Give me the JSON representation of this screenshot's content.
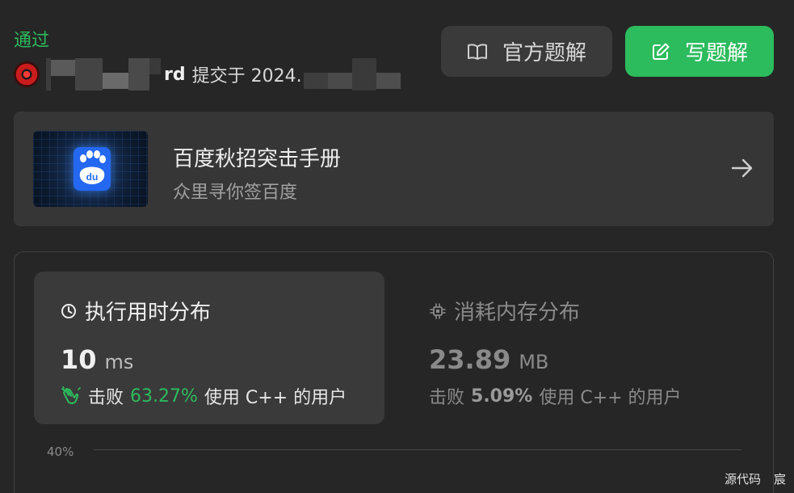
{
  "submission": {
    "status": "通过",
    "username_tail": "rd",
    "submitted_text": "提交于 2024."
  },
  "buttons": {
    "official_solution": "官方题解",
    "write_solution": "写题解"
  },
  "promo": {
    "title": "百度秋招突击手册",
    "subtitle": "众里寻你签百度",
    "logo_text": "du"
  },
  "runtime": {
    "heading": "执行用时分布",
    "value": "10",
    "unit": "ms",
    "beat_label": "击败",
    "beat_percent": "63.27%",
    "beat_suffix": "使用 C++ 的用户"
  },
  "memory": {
    "heading": "消耗内存分布",
    "value": "23.89",
    "unit": "MB",
    "beat_label": "击败",
    "beat_percent": "5.09%",
    "beat_suffix": "使用 C++ 的用户"
  },
  "chart": {
    "y_tick": "40%"
  },
  "footer": {
    "left": "源代码",
    "right": "宸"
  },
  "colors": {
    "background": "#262626",
    "accent_green": "#2cbb5d",
    "panel": "#3a3a3a",
    "promo_bg": "#363636"
  },
  "icons": [
    "user-avatar",
    "book-open-icon",
    "edit-icon",
    "baidu-paw-icon",
    "arrow-right-icon",
    "clock-icon",
    "cpu-chip-icon",
    "clapping-hands-icon"
  ]
}
